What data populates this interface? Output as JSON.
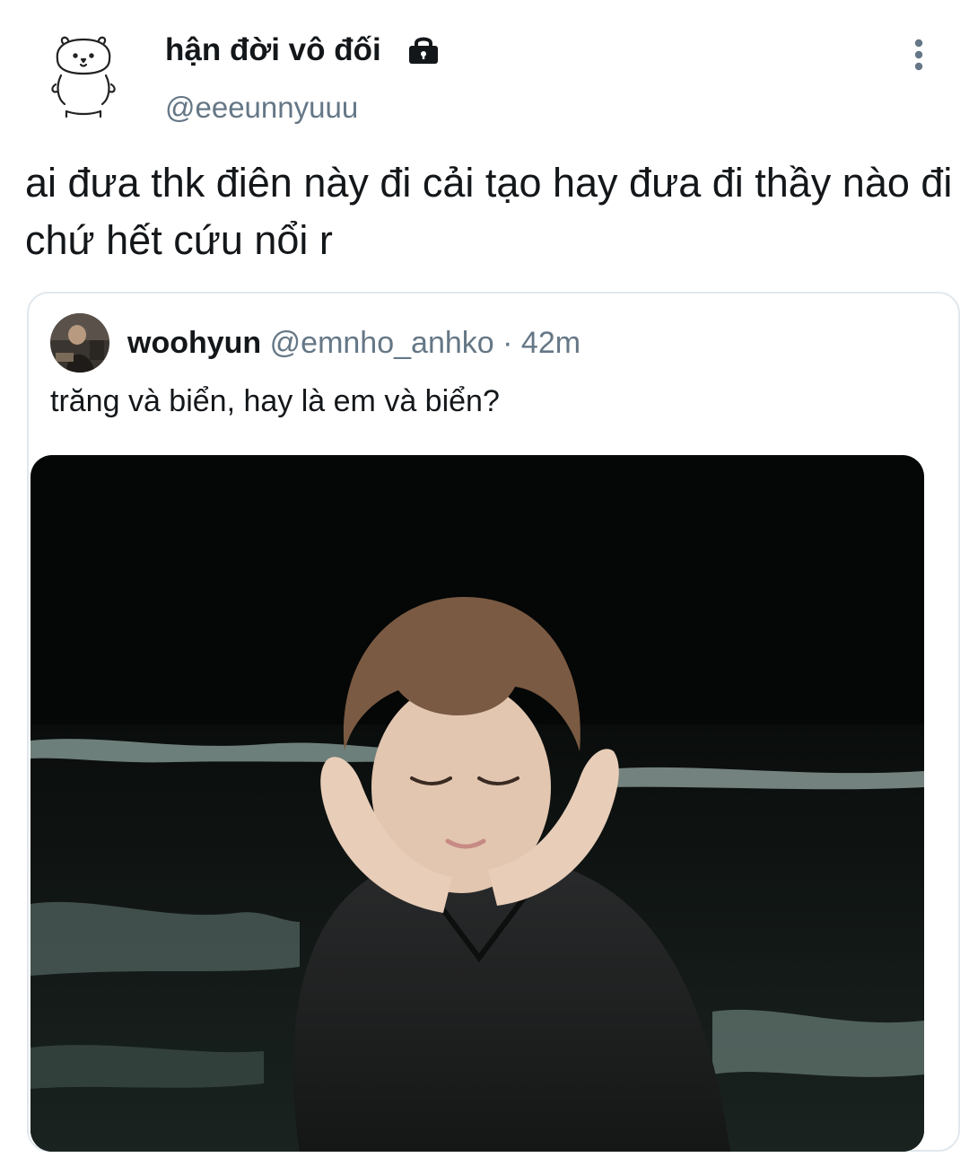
{
  "author": {
    "display_name": "hận đời vô đối",
    "handle": "@eeeunnyuuu",
    "avatar_icon": "bear-doodle-avatar-icon",
    "protected_icon": "lock-icon"
  },
  "menu": {
    "icon": "more-vertical-icon"
  },
  "tweet": {
    "text": "ai đưa thk điên này đi cải tạo hay đưa đi thầy nào đi chứ hết cứu nổi r"
  },
  "quoted_tweet": {
    "display_name": "woohyun",
    "handle": "@emnho_anhko",
    "separator": "·",
    "time": "42m",
    "text": "trăng và biển, hay là em và biển?",
    "media_description_icon": "photo-icon"
  },
  "colors": {
    "text_primary": "#14171a",
    "text_secondary": "#657786",
    "border": "#e1e8ed",
    "background": "#ffffff"
  }
}
